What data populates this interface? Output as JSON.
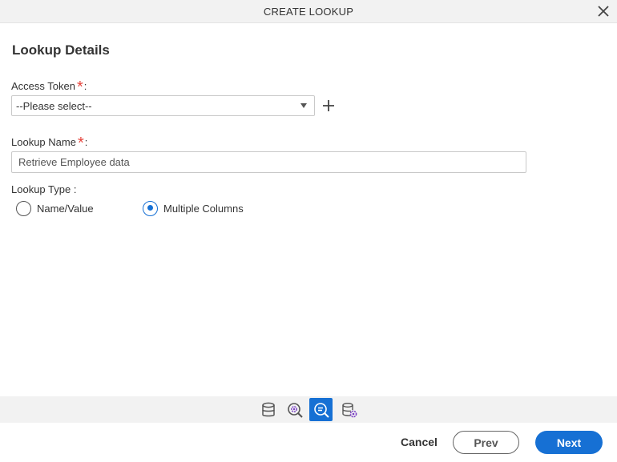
{
  "window": {
    "title": "CREATE LOOKUP"
  },
  "section": {
    "title": "Lookup Details"
  },
  "access_token": {
    "label": "Access Token",
    "required_mark": "*",
    "colon": ":",
    "selected_value": "--Please select--"
  },
  "lookup_name": {
    "label": "Lookup Name",
    "required_mark": "*",
    "colon": ":",
    "value": "Retrieve Employee data"
  },
  "lookup_type": {
    "label": "Lookup Type :",
    "options": [
      {
        "label": "Name/Value",
        "selected": false
      },
      {
        "label": "Multiple Columns",
        "selected": true
      }
    ]
  },
  "toolbar_icons": [
    "database-icon",
    "search-gear-icon",
    "search-lines-icon",
    "database-gear-icon"
  ],
  "footer": {
    "cancel_label": "Cancel",
    "prev_label": "Prev",
    "next_label": "Next"
  },
  "colors": {
    "accent": "#1670d4",
    "required": "#e6443c",
    "bar_bg": "#f2f2f2"
  }
}
